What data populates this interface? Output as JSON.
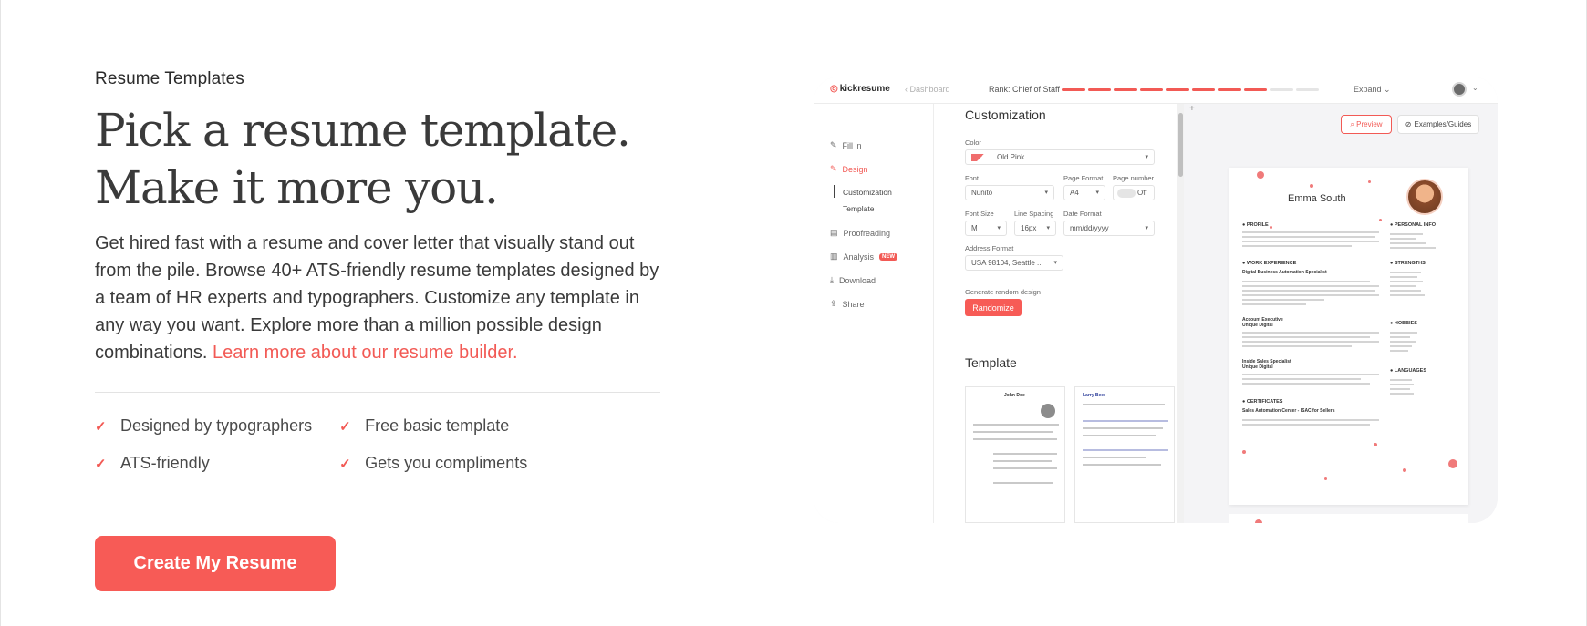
{
  "hero": {
    "eyebrow": "Resume Templates",
    "headline_line1": "Pick a resume template.",
    "headline_line2": "Make it more you.",
    "description": "Get hired fast with a resume and cover letter that visually stand out from the pile. Browse 40+ ATS-friendly resume templates designed by a team of HR experts and typographers. Customize any template in any way you want. Explore more than a million possible design combinations. ",
    "link_text": "Learn more about our resume builder.",
    "features": [
      "Designed by typographers",
      "Free basic template",
      "ATS-friendly",
      "Gets you compliments"
    ],
    "cta_label": "Create My Resume",
    "accent_color": "#f25a55",
    "check_icon": "checkmark-icon"
  },
  "app": {
    "logo_text": "kickresume",
    "breadcrumb": "Dashboard",
    "rank_label": "Rank: Chief of Staff",
    "rank_progress": 0.78,
    "expand_label": "Expand",
    "sidebar": {
      "fill_in": "Fill in",
      "design": "Design",
      "customization": "Customization",
      "template": "Template",
      "proofreading": "Proofreading",
      "analysis": "Analysis",
      "new_badge": "NEW",
      "download": "Download",
      "share": "Share"
    },
    "customization": {
      "title": "Customization",
      "color_label": "Color",
      "color_value": "Old Pink",
      "font_label": "Font",
      "font_value": "Nunito",
      "page_format_label": "Page Format",
      "page_format_value": "A4",
      "page_number_label": "Page number",
      "page_number_value": "Off",
      "font_size_label": "Font Size",
      "font_size_value": "M",
      "line_spacing_label": "Line Spacing",
      "line_spacing_value": "16px",
      "date_format_label": "Date Format",
      "date_format_value": "mm/dd/yyyy",
      "address_format_label": "Address Format",
      "address_format_value": "USA 98104, Seattle ...",
      "random_label": "Generate random design",
      "randomize": "Randomize"
    },
    "template_section": {
      "title": "Template",
      "card1_name": "John Doe",
      "card2_name": "Larry Beer"
    },
    "preview_button": "Preview",
    "examples_button": "Examples/Guides",
    "resume": {
      "name": "Emma South",
      "sections_left": [
        "PROFILE",
        "WORK EXPERIENCE",
        "CERTIFICATES"
      ],
      "sections_right": [
        "PERSONAL INFO",
        "STRENGTHS",
        "HOBBIES",
        "LANGUAGES"
      ],
      "job1": "Digital Business Automation Specialist",
      "job2": "Account Executive",
      "job2_company": "Unique Digital",
      "job3": "Inside Sales Specialist",
      "job3_company": "Unique Digital",
      "certificate": "Sales Automation Center - ISAC for Sellers"
    }
  }
}
